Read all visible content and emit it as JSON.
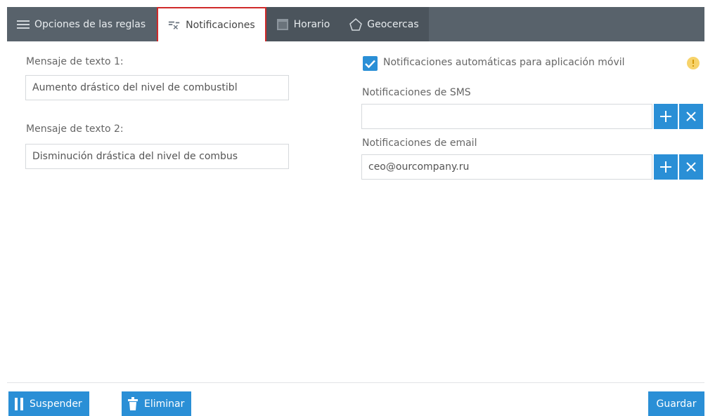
{
  "tabs": [
    {
      "label": "Opciones de las reglas",
      "icon": "list-settings-icon"
    },
    {
      "label": "Notificaciones",
      "icon": "notifications-icon"
    },
    {
      "label": "Horario",
      "icon": "calendar-icon"
    },
    {
      "label": "Geocercas",
      "icon": "geofence-icon"
    }
  ],
  "left": {
    "msg1_label": "Mensaje de texto 1:",
    "msg1_value": "Aumento drástico del nivel de combustibl",
    "msg2_label": "Mensaje de texto 2:",
    "msg2_value": "Disminución drástica del nivel de combus"
  },
  "right": {
    "auto_label": "Notificaciones automáticas para aplicación móvil",
    "sms_label": "Notificaciones de SMS",
    "sms_value": "",
    "email_label": "Notificaciones de email",
    "email_value": "ceo@ourcompany.ru"
  },
  "footer": {
    "suspend_label": "Suspender",
    "delete_label": "Eliminar",
    "save_label": "Guardar"
  },
  "colors": {
    "accent": "#2a8fd6",
    "tabbar": "#58626b",
    "active_border": "#d02a2a",
    "info": "#f2b822"
  }
}
